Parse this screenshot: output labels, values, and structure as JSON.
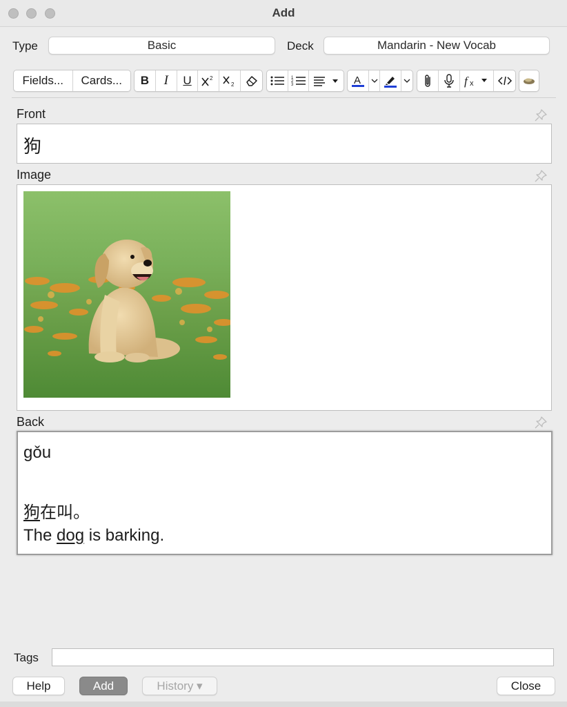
{
  "window": {
    "title": "Add"
  },
  "type_row": {
    "type_label": "Type",
    "type_value": "Basic",
    "deck_label": "Deck",
    "deck_value": "Mandarin - New Vocab"
  },
  "toolbar": {
    "fields_label": "Fields...",
    "cards_label": "Cards...",
    "bold": "B",
    "italic": "I",
    "underline": "U",
    "text_color": "#1f3fd6",
    "highlight_color": "#1f3fd6"
  },
  "fields": {
    "front": {
      "label": "Front",
      "value": "狗"
    },
    "image": {
      "label": "Image",
      "image_subject": "golden-retriever-puppy-in-grass"
    },
    "back": {
      "label": "Back",
      "line1": "gǒu",
      "line3_underlined": "狗",
      "line3_rest": "在叫。",
      "line4_pre": "The ",
      "line4_underlined": "dog",
      "line4_post": " is barking."
    }
  },
  "tags": {
    "label": "Tags",
    "value": ""
  },
  "buttons": {
    "help": "Help",
    "add": "Add",
    "history": "History ▾",
    "close": "Close"
  }
}
